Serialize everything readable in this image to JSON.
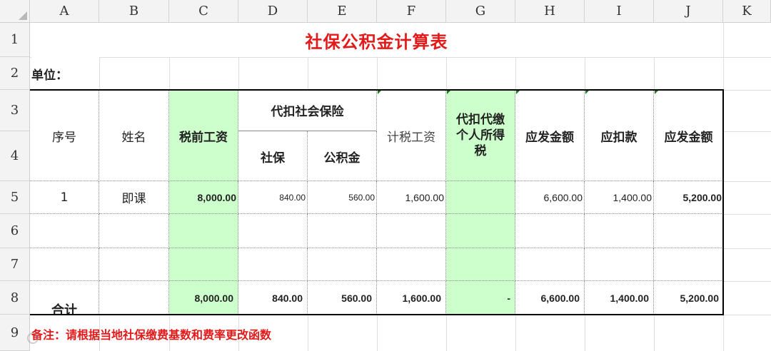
{
  "columns": [
    "A",
    "B",
    "C",
    "D",
    "E",
    "F",
    "G",
    "H",
    "I",
    "J",
    "K"
  ],
  "rows": [
    "1",
    "2",
    "3",
    "4",
    "5",
    "6",
    "7",
    "8",
    "9"
  ],
  "sheet": {
    "title": "社保公积金计算表",
    "unit_label": "单位：",
    "headers": {
      "seq": "序号",
      "name": "姓名",
      "pretax": "税前工资",
      "withheld_group": "代扣社会保险",
      "social": "社保",
      "fund": "公积金",
      "taxable": "计税工资",
      "tax_line1": "代扣代缴",
      "tax_line2": "个人所得",
      "tax_line3": "税",
      "gross": "应发金额",
      "deduct": "应扣款",
      "net": "应发金额"
    },
    "data_row": {
      "seq": "1",
      "name": "即课",
      "pretax": "8,000.00",
      "social": "840.00",
      "fund": "560.00",
      "taxable": "1,600.00",
      "tax": "",
      "gross": "6,600.00",
      "deduct": "1,400.00",
      "net": "5,200.00"
    },
    "total_row": {
      "label": "合计",
      "pretax": "8,000.00",
      "social": "840.00",
      "fund": "560.00",
      "taxable": "1,600.00",
      "tax": "-",
      "gross": "6,600.00",
      "deduct": "1,400.00",
      "net": "5,200.00"
    },
    "note": "备注：请根据当地社保缴费基数和费率更改函数"
  },
  "colors": {
    "title": "#e31a1a",
    "highlight": "#ccffcc",
    "note": "#e31a1a"
  }
}
